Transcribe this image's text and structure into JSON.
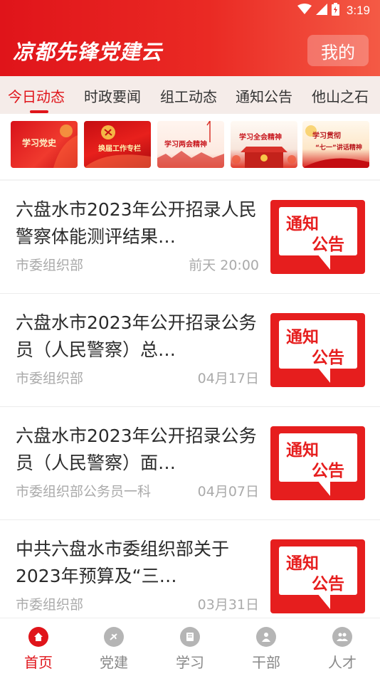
{
  "status_bar": {
    "time": "3:19",
    "icons": [
      "wifi-icon",
      "signal-icon",
      "battery-icon"
    ]
  },
  "header": {
    "title": "凉都先锋党建云",
    "mine_label": "我的"
  },
  "tabs": [
    {
      "label": "今日动态",
      "active": true
    },
    {
      "label": "时政要闻",
      "active": false
    },
    {
      "label": "组工动态",
      "active": false
    },
    {
      "label": "通知公告",
      "active": false
    },
    {
      "label": "他山之石",
      "active": false
    }
  ],
  "banners": [
    {
      "label": "学习党史"
    },
    {
      "label": "换届工作专栏"
    },
    {
      "label": "学习两会精神"
    },
    {
      "label": "学习全会精神"
    },
    {
      "label_line1": "学习贯彻",
      "label_line2": "“七一”讲话精神"
    }
  ],
  "news": [
    {
      "title": "六盘水市2023年公开招录人民警察体能测评结果…",
      "source": "市委组织部",
      "date": "前天 20:00",
      "thumb_line1": "通知",
      "thumb_line2": "公告"
    },
    {
      "title": "六盘水市2023年公开招录公务员（人民警察）总…",
      "source": "市委组织部",
      "date": "04月17日",
      "thumb_line1": "通知",
      "thumb_line2": "公告"
    },
    {
      "title": "六盘水市2023年公开招录公务员（人民警察）面…",
      "source": "市委组织部公务员一科",
      "date": "04月07日",
      "thumb_line1": "通知",
      "thumb_line2": "公告"
    },
    {
      "title": "中共六盘水市委组织部关于2023年预算及“三…",
      "source": "市委组织部",
      "date": "03月31日",
      "thumb_line1": "通知",
      "thumb_line2": "公告"
    }
  ],
  "bottom_nav": [
    {
      "label": "首页",
      "icon": "home-icon",
      "active": true
    },
    {
      "label": "党建",
      "icon": "party-emblem-icon",
      "active": false
    },
    {
      "label": "学习",
      "icon": "book-icon",
      "active": false
    },
    {
      "label": "干部",
      "icon": "person-icon",
      "active": false
    },
    {
      "label": "人才",
      "icon": "group-icon",
      "active": false
    }
  ],
  "colors": {
    "primary": "#e0141a",
    "tab_bg": "#f5ece9",
    "muted_text": "#aaaaaa",
    "nav_icon_inactive": "#b5b5b5"
  }
}
